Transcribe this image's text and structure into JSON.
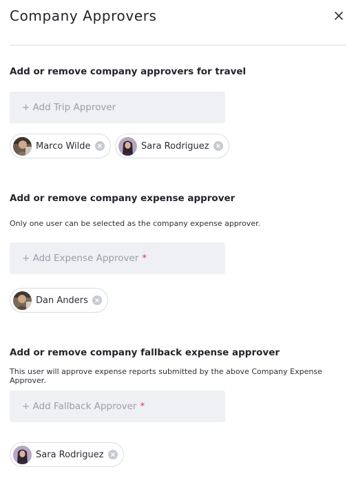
{
  "modal": {
    "title": "Company Approvers"
  },
  "travel": {
    "title": "Add or remove company approvers for travel",
    "add_placeholder": "+ Add Trip Approver",
    "approvers": [
      "Marco Wilde",
      "Sara Rodriguez"
    ]
  },
  "expense": {
    "title": "Add or remove company expense approver",
    "description": "Only one user can be selected as the company expense approver.",
    "add_placeholder": "+ Add Expense Approver",
    "required_mark": "*",
    "approvers": [
      "Dan Anders"
    ]
  },
  "fallback": {
    "title": "Add or remove company fallback expense approver",
    "description": "This user will approve expense reports submitted by the above Company Expense Approver.",
    "add_placeholder": "+ Add Fallback Approver",
    "required_mark": "*",
    "approvers": [
      "Sara Rodriguez"
    ]
  },
  "colors": {
    "field_bg": "#eef0f4",
    "required": "#e3344c",
    "chip_border": "#d9dce1",
    "remove_icon": "#c7cad0"
  }
}
